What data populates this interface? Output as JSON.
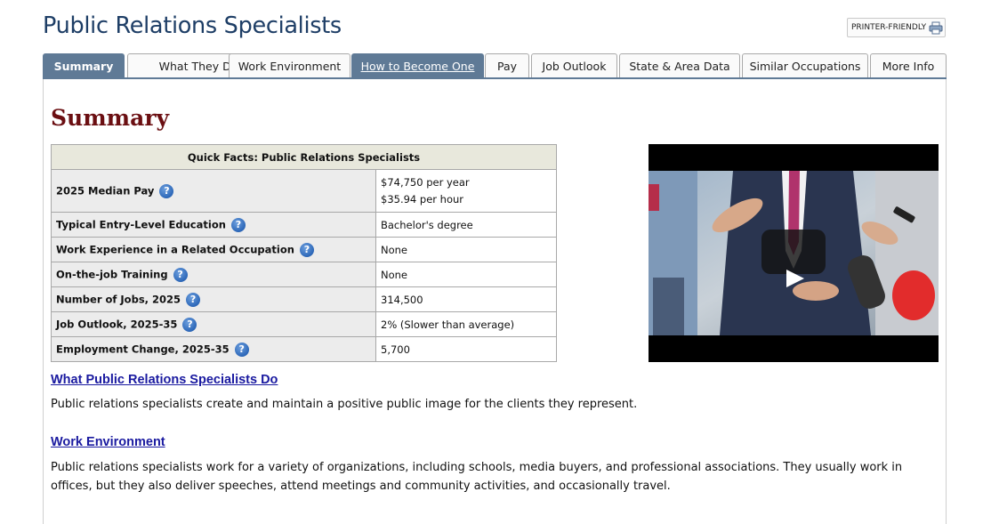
{
  "page": {
    "title": "Public Relations Specialists"
  },
  "printer": {
    "label": "PRINTER-FRIENDLY",
    "icon": "printer-icon"
  },
  "tabs": [
    {
      "label": "Summary",
      "state": "active"
    },
    {
      "label": "What They Do",
      "state": "normal"
    },
    {
      "label": "Work Environment",
      "state": "normal"
    },
    {
      "label": "How to Become One",
      "state": "hover"
    },
    {
      "label": "Pay",
      "state": "normal"
    },
    {
      "label": "Job Outlook",
      "state": "normal"
    },
    {
      "label": "State & Area Data",
      "state": "normal"
    },
    {
      "label": "Similar Occupations",
      "state": "normal"
    },
    {
      "label": "More Info",
      "state": "normal"
    }
  ],
  "summary": {
    "heading": "Summary"
  },
  "quick_facts": {
    "title": "Quick Facts: Public Relations Specialists",
    "rows": [
      {
        "label": "2025 Median Pay",
        "value": "$74,750 per year",
        "value2": "$35.94 per hour"
      },
      {
        "label": "Typical Entry-Level Education",
        "value": "Bachelor's degree"
      },
      {
        "label": "Work Experience in a Related Occupation",
        "value": "None"
      },
      {
        "label": "On-the-job Training",
        "value": "None"
      },
      {
        "label": "Number of Jobs, 2025",
        "value": "314,500"
      },
      {
        "label": "Job Outlook, 2025-35",
        "value": "2% (Slower than average)"
      },
      {
        "label": "Employment Change, 2025-35",
        "value": "5,700"
      }
    ],
    "help_icon": "?"
  },
  "video": {
    "play_icon": "play-icon"
  },
  "sections": {
    "what_they_do": {
      "link": "What Public Relations Specialists Do",
      "text": "Public relations specialists create and maintain a positive public image for the clients they represent."
    },
    "work_environment": {
      "link": "Work Environment",
      "text": "Public relations specialists work for a variety of organizations, including schools, media buyers, and professional associations. They usually work in offices, but they also deliver speeches, attend meetings and community activities, and occasionally travel."
    }
  },
  "colors": {
    "title": "#1e3e66",
    "tab_active": "#5f7a96",
    "heading": "#6b0f12",
    "link": "#1a1aa0"
  }
}
